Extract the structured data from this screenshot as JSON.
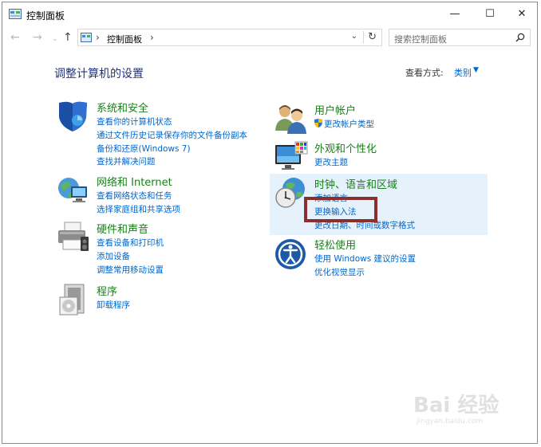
{
  "window": {
    "title": "控制面板",
    "controls": {
      "minimize": "—",
      "maximize": "☐",
      "close": "✕"
    }
  },
  "address": {
    "path": "控制面板",
    "search_placeholder": "搜索控制面板"
  },
  "main": {
    "title": "调整计算机的设置",
    "view_by_label": "查看方式:",
    "view_by_value": "类别"
  },
  "categories": {
    "system": {
      "name": "系统和安全",
      "links": [
        "查看你的计算机状态",
        "通过文件历史记录保存你的文件备份副本",
        "备份和还原(Windows 7)",
        "查找并解决问题"
      ]
    },
    "network": {
      "name": "网络和 Internet",
      "links": [
        "查看网络状态和任务",
        "选择家庭组和共享选项"
      ]
    },
    "hardware": {
      "name": "硬件和声音",
      "links": [
        "查看设备和打印机",
        "添加设备",
        "调整常用移动设置"
      ]
    },
    "programs": {
      "name": "程序",
      "links": [
        "卸载程序"
      ]
    },
    "users": {
      "name": "用户帐户",
      "links": [
        "更改帐户类型"
      ]
    },
    "appearance": {
      "name": "外观和个性化",
      "links": [
        "更改主题"
      ]
    },
    "clock": {
      "name": "时钟、语言和区域",
      "links": [
        "添加语言",
        "更换输入法",
        "更改日期、时间或数字格式"
      ]
    },
    "ease": {
      "name": "轻松使用",
      "links": [
        "使用 Windows 建议的设置",
        "优化视觉显示"
      ]
    }
  },
  "watermark": {
    "text": "Bai 经验",
    "sub": "jingyan.baidu.com"
  },
  "colors": {
    "link": "#0066cc",
    "category": "#1a7f1a",
    "title": "#1e3287",
    "highlight": "#e5f1fb",
    "annotation": "#8b2e2e"
  }
}
